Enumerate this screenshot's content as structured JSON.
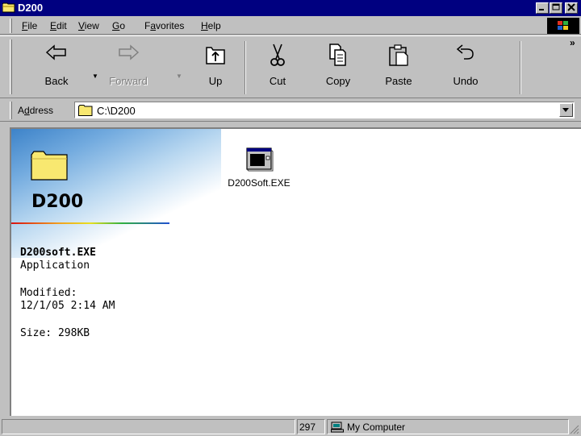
{
  "window": {
    "title": "D200"
  },
  "menu": {
    "items": [
      {
        "pre": "",
        "acc": "F",
        "post": "ile"
      },
      {
        "pre": "",
        "acc": "E",
        "post": "dit"
      },
      {
        "pre": "",
        "acc": "V",
        "post": "iew"
      },
      {
        "pre": "",
        "acc": "G",
        "post": "o"
      },
      {
        "pre": "F",
        "acc": "a",
        "post": "vorites"
      },
      {
        "pre": "",
        "acc": "H",
        "post": "elp"
      }
    ]
  },
  "toolbar": {
    "back": "Back",
    "forward": "Forward",
    "up": "Up",
    "cut": "Cut",
    "copy": "Copy",
    "paste": "Paste",
    "undo": "Undo",
    "more": "»"
  },
  "address": {
    "label_pre": "A",
    "label_acc": "d",
    "label_post": "dress",
    "path": "C:\\D200"
  },
  "panel": {
    "title": "D200",
    "file_name": "D200soft.EXE",
    "file_type": "Application",
    "modified_label": "Modified:",
    "modified_value": "12/1/05 2:14 AM",
    "size": "Size: 298KB"
  },
  "files": [
    {
      "name": "D200Soft.EXE",
      "icon": "application-window-icon"
    }
  ],
  "status": {
    "size": "297",
    "zone": "My Computer"
  },
  "colors": {
    "titlebar": "#000080",
    "face": "#c0c0c0",
    "folder": "#f8e870"
  }
}
